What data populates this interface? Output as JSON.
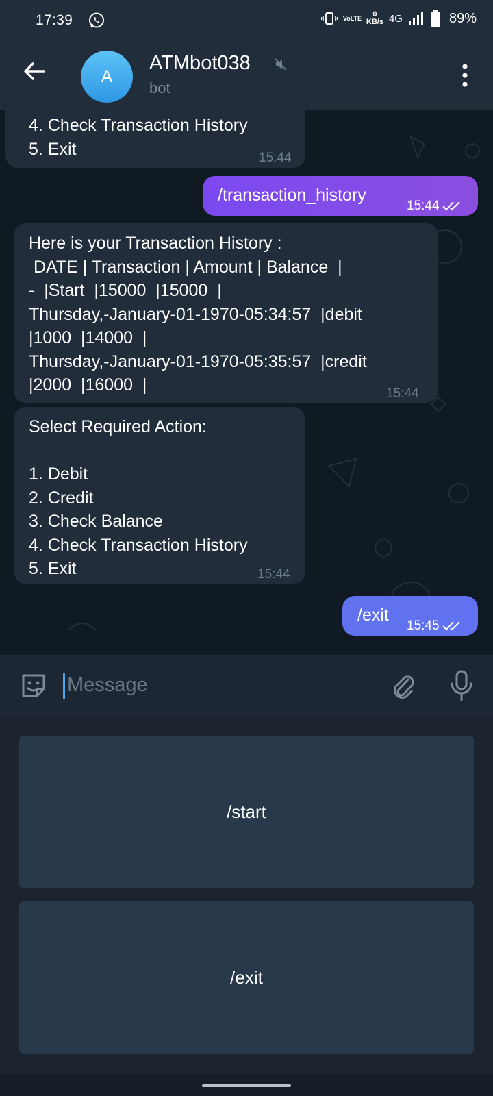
{
  "status_bar": {
    "time": "17:39",
    "whatsapp_icon": "whatsapp-icon",
    "volte": "VoLTE",
    "network_speed_value": "0",
    "network_speed_unit": "KB/s",
    "network_type": "4G",
    "battery": "89%"
  },
  "header": {
    "avatar_letter": "A",
    "title": "ATMbot038",
    "subtitle": "bot"
  },
  "messages": {
    "m1": {
      "text": "4. Check Transaction History\n5. Exit",
      "time": "15:44"
    },
    "m2": {
      "text": "/transaction_history",
      "time": "15:44"
    },
    "m3": {
      "text": "Here is your Transaction History :\n DATE | Transaction | Amount | Balance  |\n-  |Start  |15000  |15000  |\nThursday,-January-01-1970-05:34:57  |debit\n|1000  |14000  |\nThursday,-January-01-1970-05:35:57  |credit\n|2000  |16000  |",
      "time": "15:44"
    },
    "m4": {
      "text": "Select Required Action:\n\n1. Debit\n2. Credit\n3. Check Balance\n4. Check Transaction History\n5. Exit",
      "time": "15:44"
    },
    "m5": {
      "text": "/exit",
      "time": "15:45"
    }
  },
  "input": {
    "placeholder": "Message"
  },
  "keyboard": {
    "button1": "/start",
    "button2": "/exit"
  },
  "colors": {
    "header_bg": "#212d3b",
    "chat_bg": "#0f1a22",
    "incoming_bubble": "#212d3b",
    "outgoing_bubble": "#7b49f0",
    "keyboard_button": "#27394a",
    "accent": "#4ea3ea"
  }
}
